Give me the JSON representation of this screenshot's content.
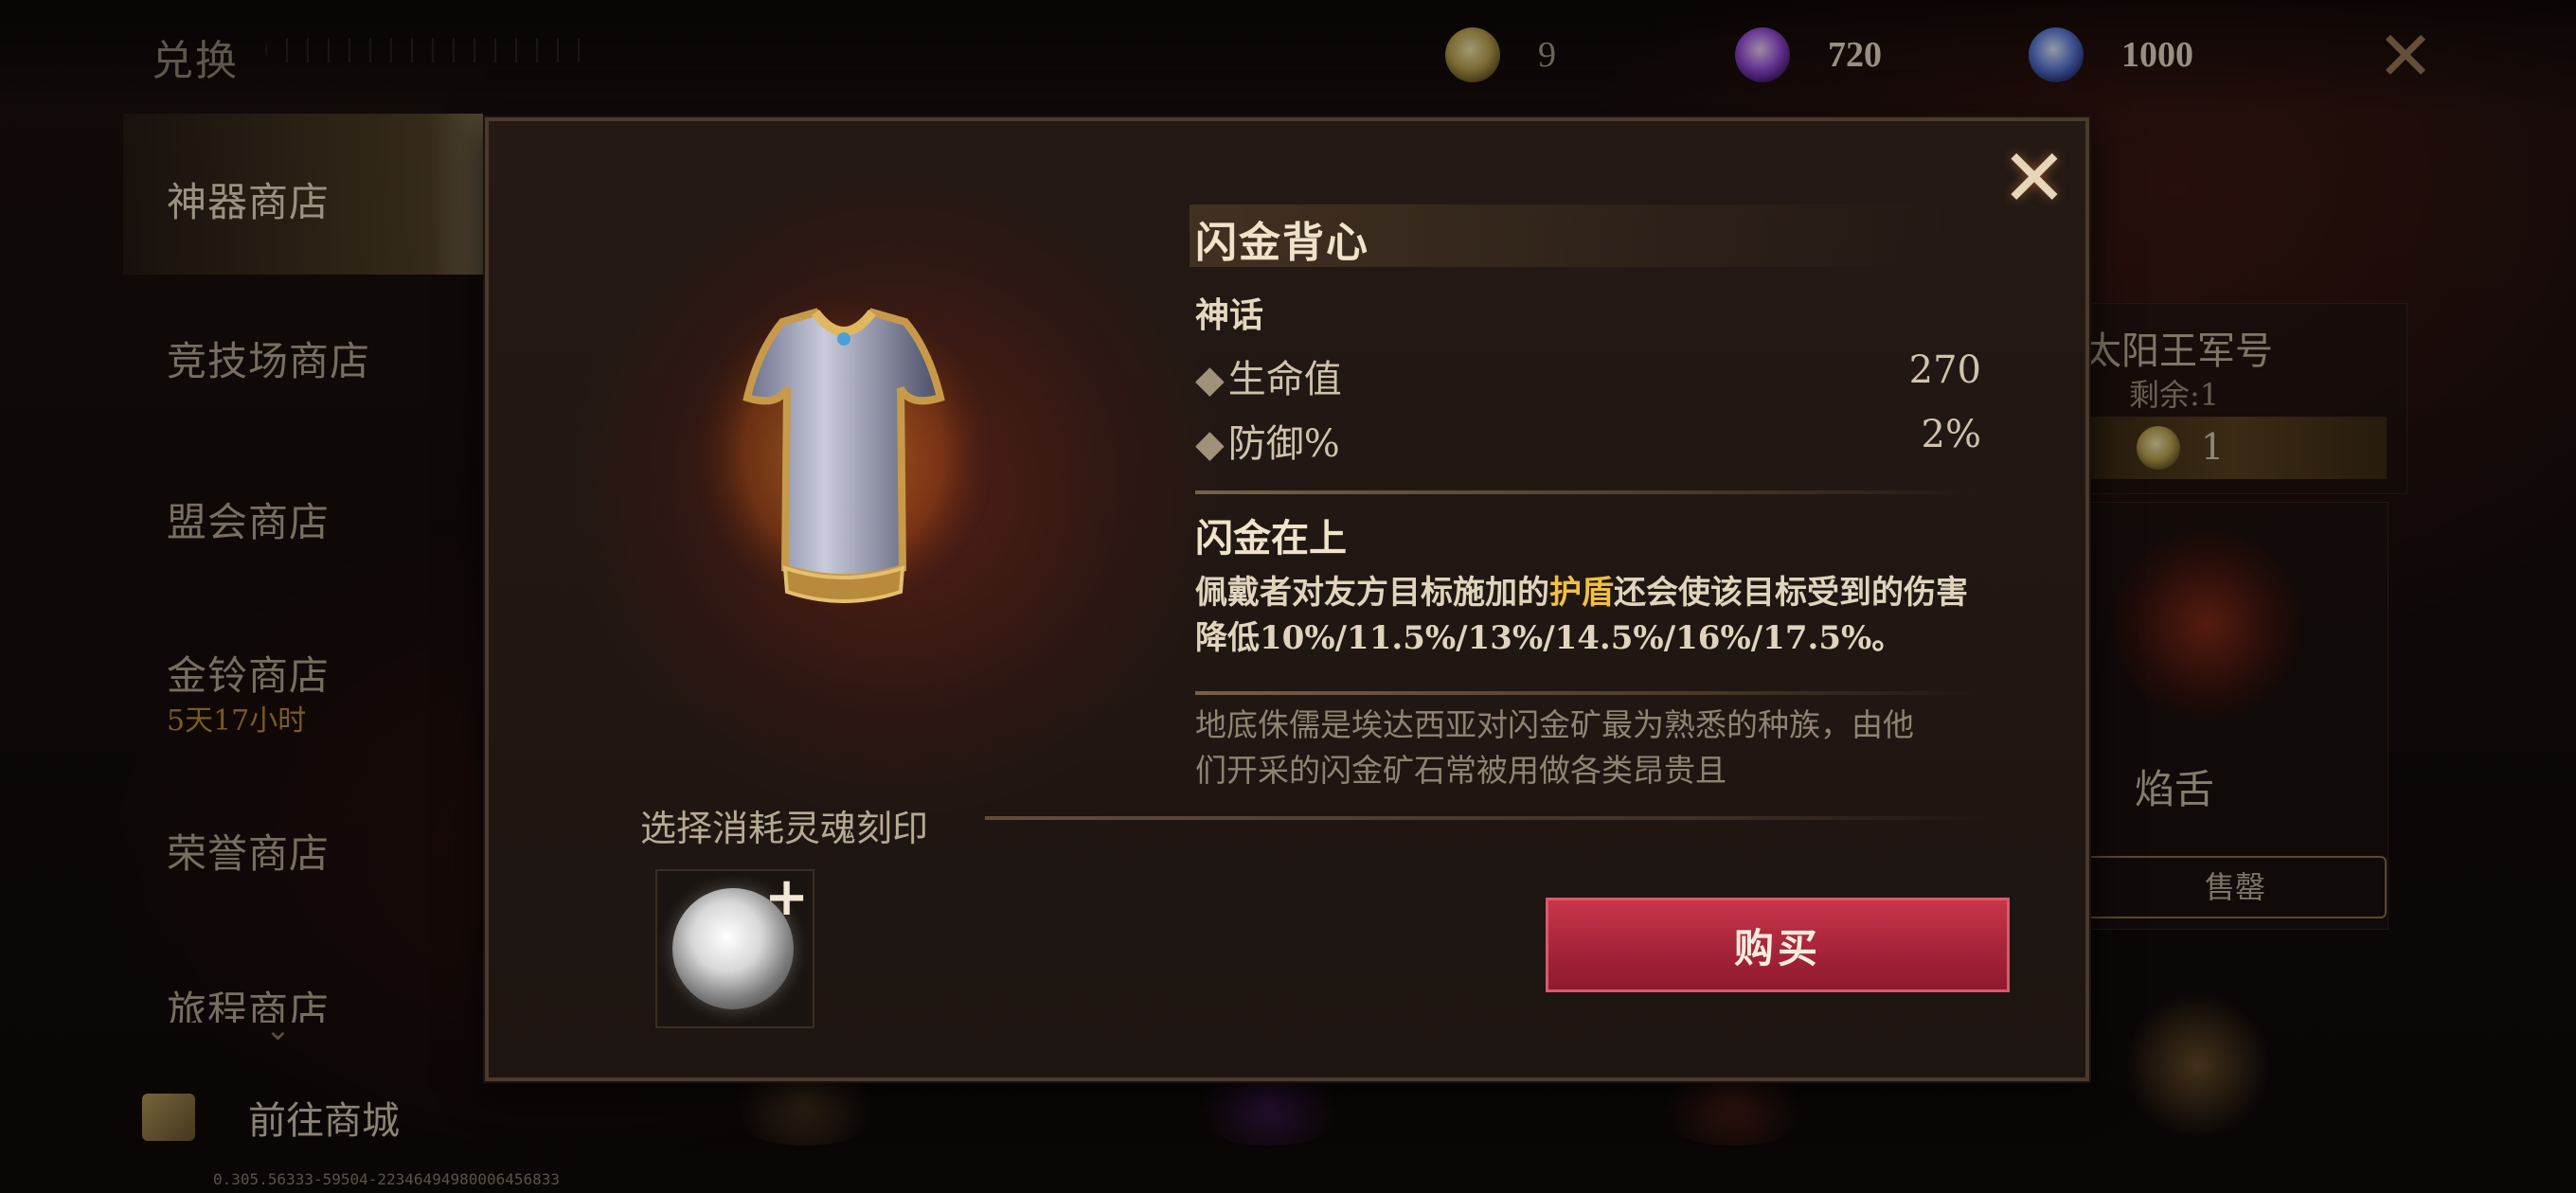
{
  "header": {
    "title": "兑换",
    "currencies": [
      {
        "icon": "gold-coin-icon",
        "value": "9"
      },
      {
        "icon": "purple-orb-icon",
        "value": "720"
      },
      {
        "icon": "blue-orb-icon",
        "value": "1000"
      }
    ]
  },
  "sidebar": {
    "items": [
      {
        "label": "神器商店",
        "active": true
      },
      {
        "label": "竞技场商店"
      },
      {
        "label": "盟会商店"
      },
      {
        "label": "金铃商店",
        "sub": "5天17小时"
      },
      {
        "label": "荣誉商店"
      },
      {
        "label": "旅程商店"
      }
    ],
    "goto_mall": "前往商城",
    "debug": "0.305.56333-59504-22346494980006456833"
  },
  "background_cards": {
    "card1_title": "太阳王军号",
    "card1_remain": "剩余:1",
    "card1_price": "1",
    "card2_name": "焰舌",
    "card2_button": "售罄"
  },
  "modal": {
    "item_name": "闪金背心",
    "rarity": "神话",
    "stats": [
      {
        "label": "生命值",
        "value": "270"
      },
      {
        "label": "防御%",
        "value": "2%"
      }
    ],
    "skill_name": "闪金在上",
    "skill_desc_pre": "佩戴者对友方目标施加的",
    "skill_desc_hl": "护盾",
    "skill_desc_post": "还会使该目标受到的伤害降低10%/11.5%/13%/14.5%/16%/17.5%。",
    "lore": "地底侏儒是埃达西亚对闪金矿最为熟悉的种族，由他们开采的闪金矿石常被用做各类昂贵且",
    "choose_label": "选择消耗灵魂刻印",
    "buy_label": "购买"
  },
  "colors": {
    "buy_button": "#a7243a",
    "highlight": "#f0c040",
    "timer": "#c08a2e"
  }
}
